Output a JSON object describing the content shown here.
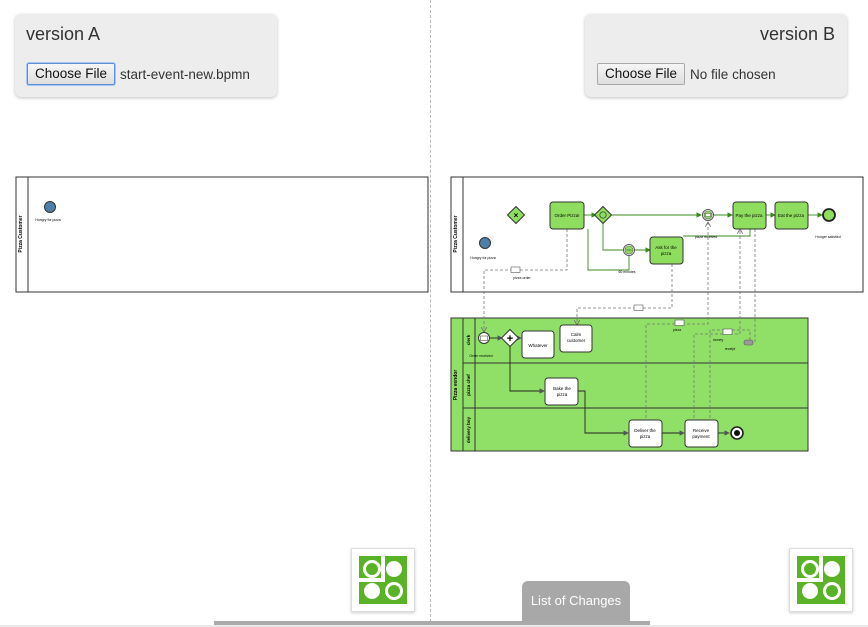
{
  "version_a": {
    "title": "version A",
    "button_label": "Choose File",
    "file_name": "start-event-new.bpmn"
  },
  "version_b": {
    "title": "version B",
    "button_label": "Choose File",
    "file_name": "No file chosen"
  },
  "diagram_a": {
    "pool_label": "Pizza Customer",
    "start_event_label": "Hungry for pizza"
  },
  "diagram_b": {
    "customer_pool_label": "Pizza Customer",
    "vendor_pool_label": "Pizza vendor",
    "lanes": [
      "clerk",
      "pizza chef",
      "delivery boy"
    ],
    "tasks": {
      "order": "Order Pizza!",
      "pay": "Pay the pizza",
      "eat": "Eat the pizza",
      "ask": [
        "Ask for the",
        "pizza"
      ],
      "whatever": "Whatever",
      "calm": [
        "Calm",
        "customer"
      ],
      "bake": [
        "Bake the",
        "pizza"
      ],
      "deliver": [
        "Deliver the",
        "pizza"
      ],
      "receive": [
        "Receive",
        "payment"
      ]
    },
    "labels": {
      "hungry": "Hungry for pizza",
      "satisfied": "Hunger satisfied",
      "pizza_received": "pizza received",
      "sixty_minutes": "60 minutes",
      "pizza_order": "pizza order",
      "order_received": "Order received",
      "pizza": "pizza",
      "money": "money",
      "receipt": "receipt"
    },
    "colors": {
      "task_fill": "#8fdd5e",
      "lane_fill": "#90e067",
      "start_event_fill": "#4d7fa8",
      "end_event_fill": "#8fdd5e"
    }
  },
  "footer": {
    "changes_tab_label": "List of Changes",
    "logo_icon": "puzzle-gears-icon",
    "logo_color": "#5ab226"
  }
}
